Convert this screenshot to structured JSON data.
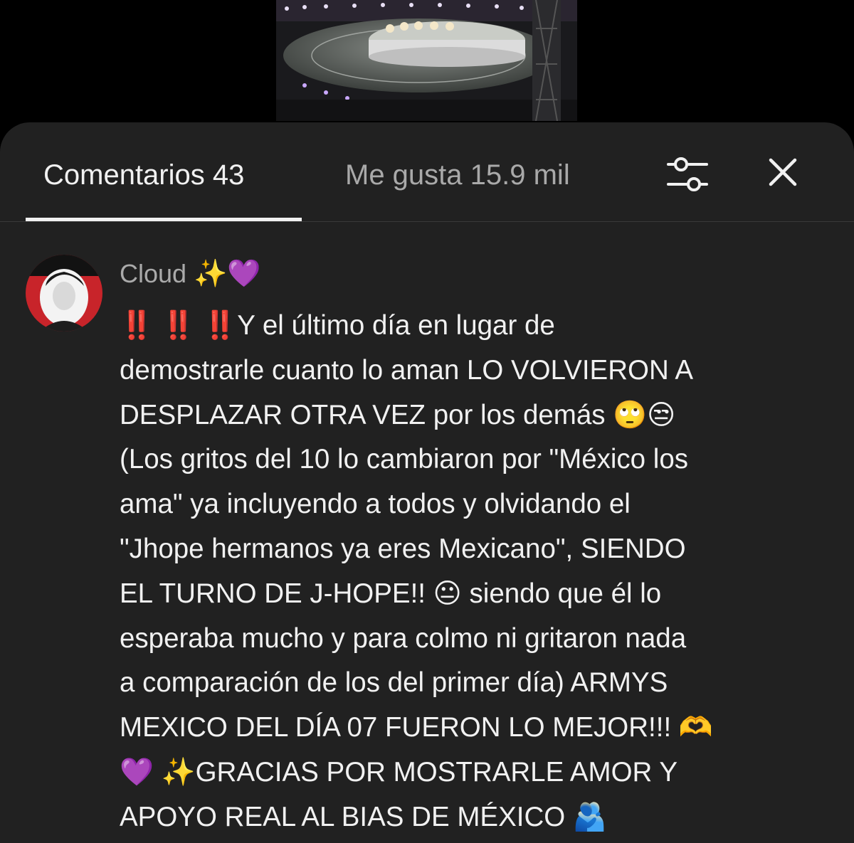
{
  "video": {
    "thumbnail_desc_icon": "concert-stage-thumbnail"
  },
  "tabs": {
    "comments_label": "Comentarios 43",
    "likes_label": "Me gusta 15.9 mil",
    "filter_icon": "filter-sliders-icon",
    "close_icon": "close-icon"
  },
  "comment": {
    "author": "Cloud",
    "author_emojis": "✨💜",
    "lines": [
      "‼️ ‼️ ‼️Y el último día en lugar de",
      "demostrarle cuanto lo aman LO VOLVIERON A",
      "DESPLAZAR OTRA VEZ por los demás 🙄😒",
      "(Los gritos del 10 lo cambiaron por \"México los",
      "ama\" ya incluyendo a todos y olvidando el",
      "\"Jhope hermanos ya eres Mexicano\", SIENDO",
      "EL TURNO DE J-HOPE!! 😐 siendo que él lo",
      "esperaba mucho y para colmo ni gritaron nada",
      "a comparación de los del primer día) ARMYS",
      "MEXICO DEL DÍA 07 FUERON LO MEJOR!!! 🫶",
      "💜 ✨GRACIAS POR MOSTRARLE AMOR Y",
      "APOYO REAL AL BIAS DE MÉXICO 🫂"
    ]
  },
  "colors": {
    "background": "#000000",
    "sheet": "#212121",
    "primary_text": "#f1f1f1",
    "secondary_text": "#aaaaaa"
  }
}
